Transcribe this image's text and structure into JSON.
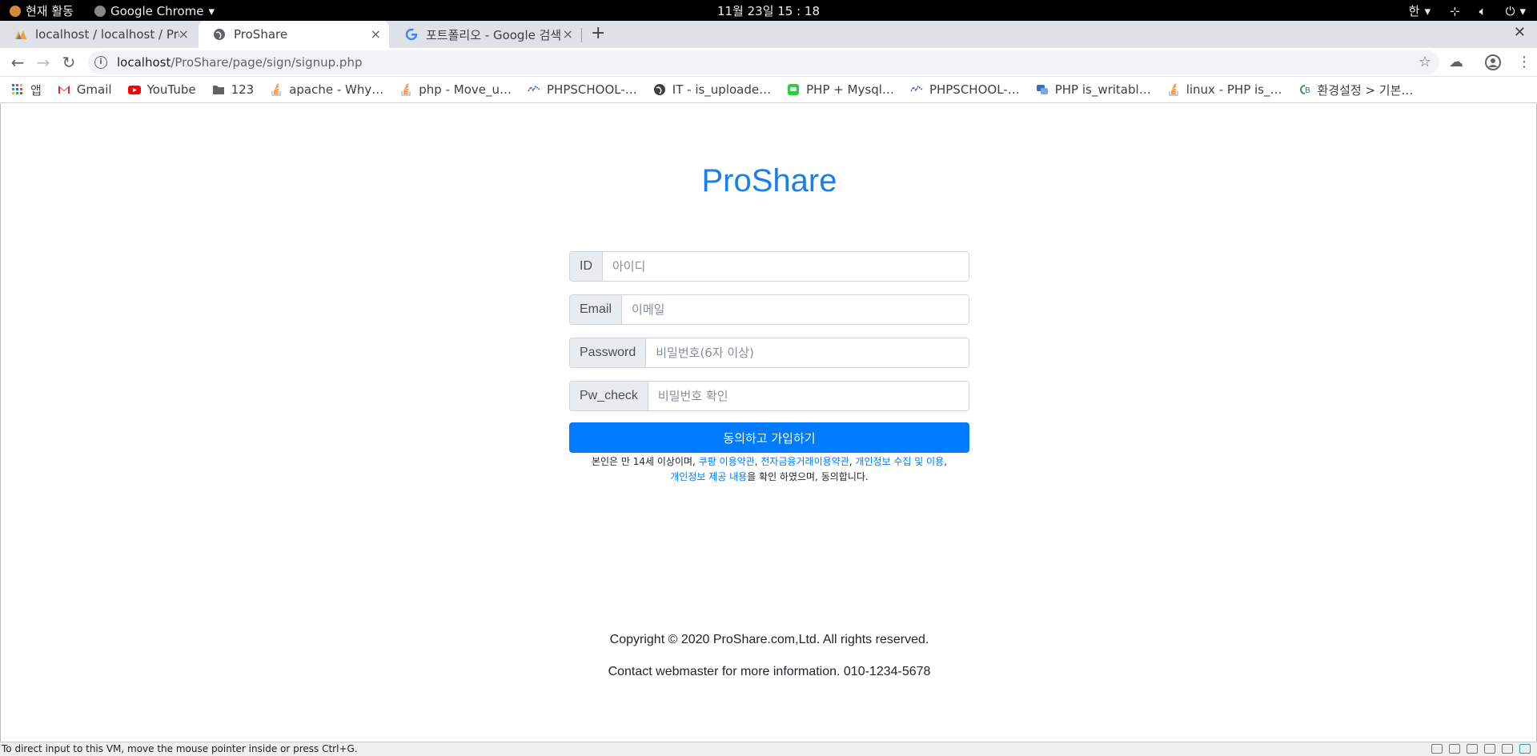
{
  "system_bar": {
    "activities": "현재 활동",
    "app_menu": "Google Chrome",
    "clock": "11월 23일  15 : 18",
    "input_method": "한"
  },
  "tabs": [
    {
      "title": "localhost / localhost / Pro"
    },
    {
      "title": "ProShare"
    },
    {
      "title": "포트폴리오 - Google 검색"
    }
  ],
  "address_bar": {
    "host": "localhost",
    "path": "/ProShare/page/sign/signup.php"
  },
  "bookmarks": [
    {
      "label": "앱"
    },
    {
      "label": "Gmail"
    },
    {
      "label": "YouTube"
    },
    {
      "label": "123"
    },
    {
      "label": "apache - Why…"
    },
    {
      "label": "php - Move_u…"
    },
    {
      "label": "PHPSCHOOL-…"
    },
    {
      "label": "IT - is_uploade…"
    },
    {
      "label": "PHP + Mysql…"
    },
    {
      "label": "PHPSCHOOL-…"
    },
    {
      "label": "PHP is_writabl…"
    },
    {
      "label": "linux - PHP is_…"
    },
    {
      "label": "환경설정 > 기본…"
    }
  ],
  "page": {
    "brand": "ProShare",
    "fields": [
      {
        "label": "ID",
        "placeholder": "아이디"
      },
      {
        "label": "Email",
        "placeholder": "이메일"
      },
      {
        "label": "Password",
        "placeholder": "비밀번호(6자 이상)"
      },
      {
        "label": "Pw_check",
        "placeholder": "비밀번호 확인"
      }
    ],
    "submit_label": "동의하고 가입하기",
    "terms": {
      "prefix": "본인은 만 14세 이상이며, ",
      "link1": "쿠팡 이용약관",
      "sep1": ", ",
      "link2": "전자금융거래이용약관",
      "sep2": ", ",
      "link3": "개인정보 수집 및 이용",
      "sep3": ", ",
      "link4": "개인정보 제공 내용",
      "suffix": "을 확인 하였으며, 동의합니다."
    },
    "copyright": "Copyright © 2020 ProShare.com,Ltd. All rights reserved.",
    "contact": "Contact webmaster for more information. 010-1234-5678"
  },
  "vm_status": "To direct input to this VM, move the mouse pointer inside or press Ctrl+G.",
  "colors": {
    "brand": "#1a7fe6",
    "primary_button": "#007bff"
  }
}
